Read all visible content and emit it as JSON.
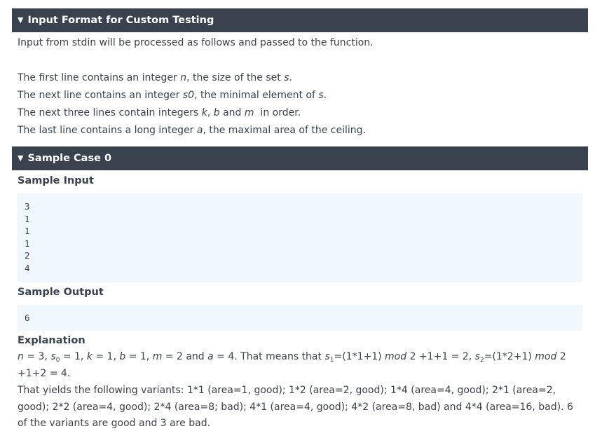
{
  "input_format": {
    "header": "Input Format for Custom Testing",
    "caret": "▼",
    "intro": "Input from stdin will be processed as follows and passed to the function.",
    "lines": [
      "The first line contains an integer n, the size of the set s.",
      "The next line contains an integer s0, the minimal element of s.",
      "The next three lines contain integers k, b and m  in order.",
      "The last line contains a long integer a, the maximal area of the ceiling."
    ]
  },
  "sample_case": {
    "header": "Sample Case 0",
    "caret": "▼",
    "input_label": "Sample Input",
    "input_lines": [
      "3",
      "1",
      "1",
      "1",
      "2",
      "4"
    ],
    "output_label": "Sample Output",
    "output_lines": [
      "6"
    ],
    "explanation_label": "Explanation",
    "explanation_formula": "n = 3, s0 = 1, k = 1, b = 1, m = 2 and a = 4. That means that s1=(1*1+1) mod 2 +1+1 = 2, s2=(1*2+1) mod 2 +1+2 = 4.",
    "explanation_text": "That yields the following variants: 1*1 (area=1, good); 1*2 (area=2, good); 1*4 (area=4, good); 2*1 (area=2, good); 2*2 (area=4, good); 2*4 (area=8; bad); 4*1 (area=4, good); 4*2 (area=8, bad) and 4*4 (area=16, bad). 6 of the variants are good and 3 are bad."
  }
}
